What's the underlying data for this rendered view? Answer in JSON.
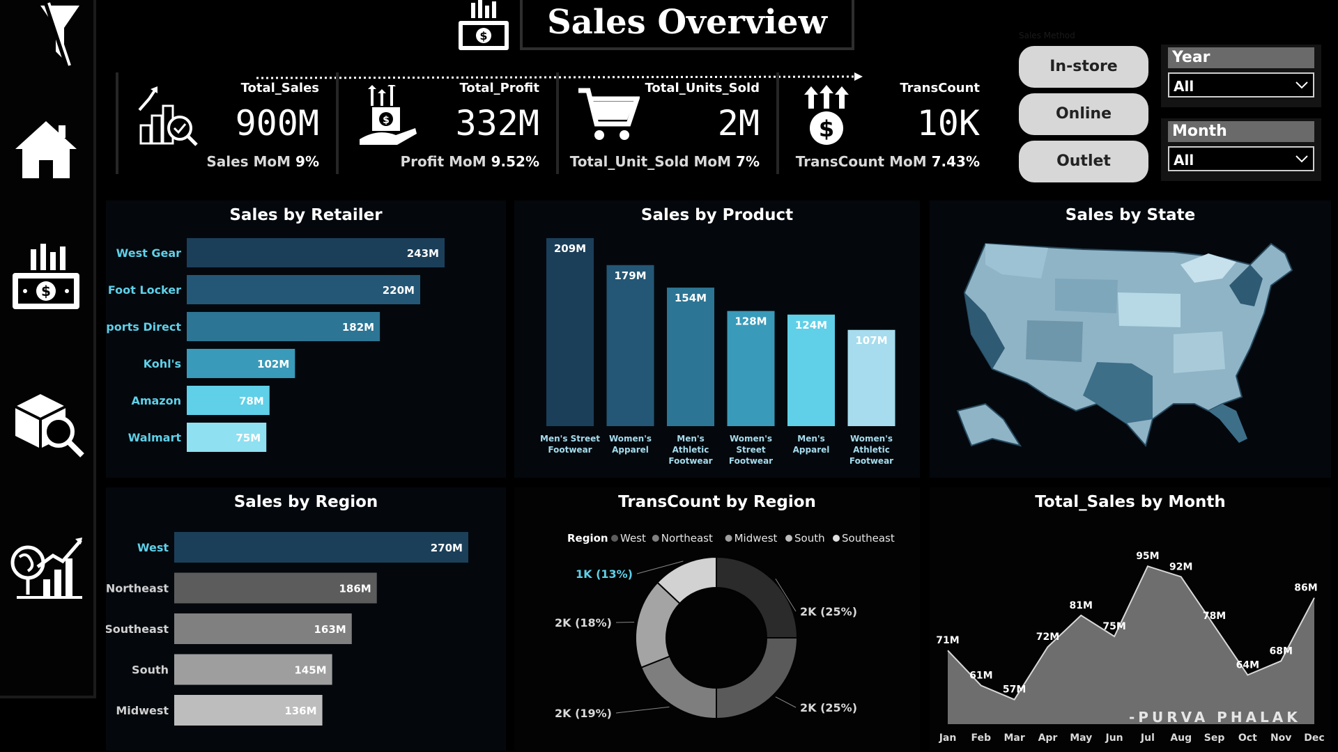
{
  "header": {
    "title": "Sales Overview"
  },
  "nav": {
    "items": [
      {
        "icon": "filter-off-icon"
      },
      {
        "icon": "home-icon"
      },
      {
        "icon": "sales-money-icon"
      },
      {
        "icon": "product-search-icon"
      },
      {
        "icon": "globe-growth-icon"
      }
    ]
  },
  "kpis": [
    {
      "label": "Total_Sales",
      "value": "900M",
      "mom_label": "Sales MoM",
      "mom_value": "9%",
      "icon": "sales-growth-icon"
    },
    {
      "label": "Total_Profit",
      "value": "332M",
      "mom_label": "Profit MoM",
      "mom_value": "9.52%",
      "icon": "profit-hand-icon"
    },
    {
      "label": "Total_Units_Sold",
      "value": "2M",
      "mom_label": "Total_Unit_Sold MoM",
      "mom_value": "7%",
      "icon": "cart-icon"
    },
    {
      "label": "TransCount",
      "value": "10K",
      "mom_label": "TransCount MoM",
      "mom_value": "7.43%",
      "icon": "dollar-arrows-icon"
    }
  ],
  "filters": {
    "sales_method_label": "Sales Method",
    "methods": [
      "In-store",
      "Online",
      "Outlet"
    ],
    "year": {
      "label": "Year",
      "value": "All"
    },
    "month": {
      "label": "Month",
      "value": "All"
    }
  },
  "colors": {
    "blue_ramp": [
      "#1c3f59",
      "#245775",
      "#2d7594",
      "#3a9ab9",
      "#5fd0e8",
      "#a6dced"
    ],
    "grey_ramp": [
      "#5c5c5c",
      "#808080",
      "#9e9e9e",
      "#bdbdbd"
    ],
    "area_fill": "#6e6e6e"
  },
  "signature": "-PURVA PHALAK",
  "chart_data": [
    {
      "type": "bar",
      "orientation": "horizontal",
      "title": "Sales by Retailer",
      "categories": [
        "West Gear",
        "Foot Locker",
        "Sports Direct",
        "Kohl's",
        "Amazon",
        "Walmart"
      ],
      "values": [
        243,
        220,
        182,
        102,
        78,
        75
      ],
      "labels": [
        "243M",
        "220M",
        "182M",
        "102M",
        "78M",
        "75M"
      ]
    },
    {
      "type": "bar",
      "orientation": "vertical",
      "title": "Sales by Product",
      "categories": [
        "Men's Street Footwear",
        "Women's Apparel",
        "Men's Athletic Footwear",
        "Women's Street Footwear",
        "Men's Apparel",
        "Women's Athletic Footwear"
      ],
      "category_lines": [
        [
          "Men's Street",
          "Footwear"
        ],
        [
          "Women's",
          "Apparel"
        ],
        [
          "Men's",
          "Athletic",
          "Footwear"
        ],
        [
          "Women's",
          "Street",
          "Footwear"
        ],
        [
          "Men's",
          "Apparel"
        ],
        [
          "Women's",
          "Athletic",
          "Footwear"
        ]
      ],
      "values": [
        209,
        179,
        154,
        128,
        124,
        107
      ],
      "labels": [
        "209M",
        "179M",
        "154M",
        "128M",
        "124M",
        "107M"
      ]
    },
    {
      "type": "heatmap",
      "title": "Sales by State",
      "map": "United States (choropleth)"
    },
    {
      "type": "bar",
      "orientation": "horizontal",
      "title": "Sales by Region",
      "categories": [
        "West",
        "Northeast",
        "Southeast",
        "South",
        "Midwest"
      ],
      "values": [
        270,
        186,
        163,
        145,
        136
      ],
      "labels": [
        "270M",
        "186M",
        "163M",
        "145M",
        "136M"
      ]
    },
    {
      "type": "pie",
      "variant": "donut",
      "title": "TransCount by Region",
      "legend_title": "Region",
      "legend_placement": "top",
      "series": [
        {
          "name": "West",
          "value": 25,
          "label": "2K (25%)"
        },
        {
          "name": "Northeast",
          "value": 25,
          "label": "2K (25%)"
        },
        {
          "name": "Midwest",
          "value": 19,
          "label": "2K (19%)"
        },
        {
          "name": "South",
          "value": 18,
          "label": "2K (18%)"
        },
        {
          "name": "Southeast",
          "value": 13,
          "label": "1K (13%)"
        }
      ]
    },
    {
      "type": "area",
      "title": "Total_Sales by Month",
      "categories": [
        "Jan",
        "Feb",
        "Mar",
        "Apr",
        "May",
        "Jun",
        "Jul",
        "Aug",
        "Sep",
        "Oct",
        "Nov",
        "Dec"
      ],
      "values": [
        71,
        61,
        57,
        72,
        81,
        75,
        95,
        92,
        78,
        64,
        68,
        86
      ],
      "labels": [
        "71M",
        "61M",
        "57M",
        "72M",
        "81M",
        "75M",
        "95M",
        "92M",
        "78M",
        "64M",
        "68M",
        "86M"
      ],
      "ylim": [
        50,
        100
      ]
    }
  ]
}
